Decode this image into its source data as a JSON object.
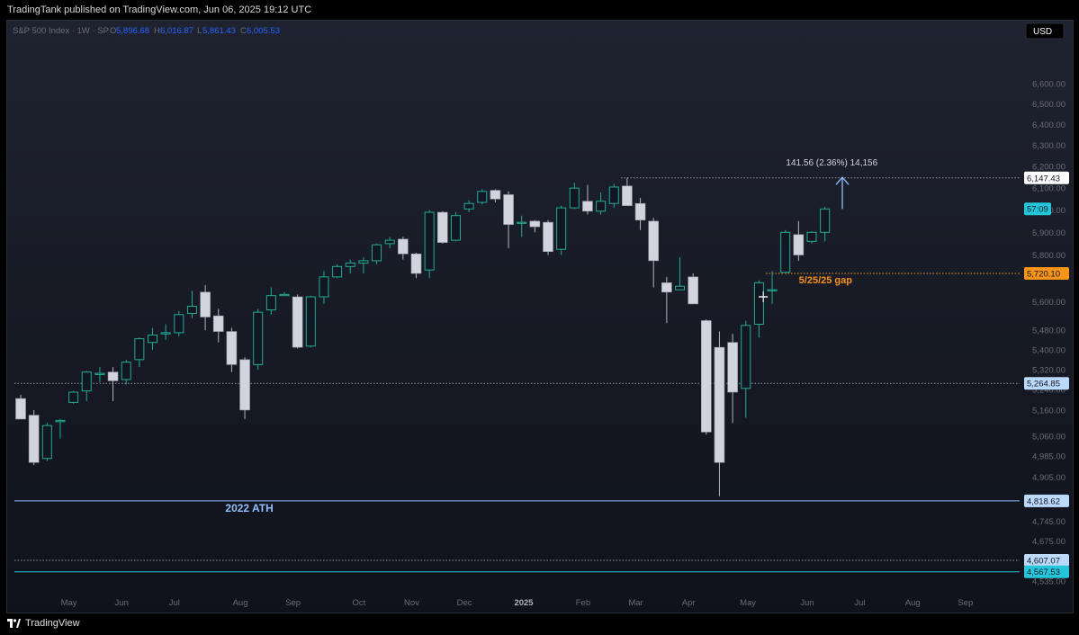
{
  "header": {
    "publish_text": "TradingTank published on TradingView.com, Jun 06, 2025 19:12 UTC"
  },
  "footer": {
    "brand": "TradingView"
  },
  "symbol_info": {
    "name": "S&P 500 Index · 1W · SP",
    "open_label": "O",
    "open": "5,896.68",
    "high_label": "H",
    "high": "6,016.87",
    "low_label": "L",
    "low": "5,861.43",
    "close_label": "C",
    "close": "6,005.53"
  },
  "currency": "USD",
  "colors": {
    "up": "#22ab94",
    "down_fill": "#d1d4dc",
    "bg": "#121622",
    "axis_text": "#6a6d78",
    "orange": "#f7931a",
    "blue_line": "#90bff9",
    "teal_line": "#26c6da"
  },
  "chart_data": {
    "type": "candlestick",
    "title": "S&P 500 Index · 1W · SP",
    "ylim": [
      4545,
      6745
    ],
    "y_scale": "log",
    "y_ticks": [
      6600,
      6500,
      6400,
      6300,
      6200,
      6100,
      6000,
      5900,
      5800,
      5720,
      5600,
      5480,
      5400,
      5320,
      5240,
      5160,
      5060,
      4985,
      4905,
      4818,
      4745,
      4675,
      4607,
      4535
    ],
    "y_tick_labels": [
      "6,600.00",
      "6,500.00",
      "6,400.00",
      "6,300.00",
      "6,200.00",
      "6,100.00",
      "6,000.00",
      "5,900.00",
      "5,800.00",
      "5,720.00",
      "5,600.00",
      "5,480.00",
      "5,400.00",
      "5,320.00",
      "5,240.00",
      "5,160.00",
      "5,060.00",
      "4,985.00",
      "4,905.00",
      "4,818.00",
      "4,745.00",
      "4,675.00",
      "4,607.00",
      "4,535.00"
    ],
    "x_labels": [
      {
        "label": "May",
        "week": 4
      },
      {
        "label": "Jun",
        "week": 8
      },
      {
        "label": "Jul",
        "week": 12
      },
      {
        "label": "Aug",
        "week": 17
      },
      {
        "label": "Sep",
        "week": 21
      },
      {
        "label": "Oct",
        "week": 26
      },
      {
        "label": "Nov",
        "week": 30
      },
      {
        "label": "Dec",
        "week": 34
      },
      {
        "label": "2025",
        "week": 38.5
      },
      {
        "label": "Feb",
        "week": 43
      },
      {
        "label": "Mar",
        "week": 47
      },
      {
        "label": "Apr",
        "week": 51
      },
      {
        "label": "May",
        "week": 55.5
      },
      {
        "label": "Jun",
        "week": 60
      },
      {
        "label": "Jul",
        "week": 64
      },
      {
        "label": "Aug",
        "week": 68
      },
      {
        "label": "Sep",
        "week": 72
      }
    ],
    "candles": [
      {
        "o": 5205,
        "h": 5220,
        "l": 5130,
        "c": 5125
      },
      {
        "o": 5140,
        "h": 5160,
        "l": 4950,
        "c": 4960
      },
      {
        "o": 4975,
        "h": 5110,
        "l": 4965,
        "c": 5100
      },
      {
        "o": 5115,
        "h": 5125,
        "l": 5050,
        "c": 5120
      },
      {
        "o": 5190,
        "h": 5235,
        "l": 5185,
        "c": 5230
      },
      {
        "o": 5235,
        "h": 5315,
        "l": 5195,
        "c": 5310
      },
      {
        "o": 5300,
        "h": 5330,
        "l": 5270,
        "c": 5305
      },
      {
        "o": 5310,
        "h": 5330,
        "l": 5195,
        "c": 5275
      },
      {
        "o": 5280,
        "h": 5360,
        "l": 5260,
        "c": 5350
      },
      {
        "o": 5360,
        "h": 5450,
        "l": 5330,
        "c": 5445
      },
      {
        "o": 5430,
        "h": 5490,
        "l": 5400,
        "c": 5460
      },
      {
        "o": 5465,
        "h": 5505,
        "l": 5440,
        "c": 5470
      },
      {
        "o": 5470,
        "h": 5560,
        "l": 5455,
        "c": 5545
      },
      {
        "o": 5550,
        "h": 5645,
        "l": 5530,
        "c": 5580
      },
      {
        "o": 5640,
        "h": 5670,
        "l": 5480,
        "c": 5535
      },
      {
        "o": 5540,
        "h": 5570,
        "l": 5430,
        "c": 5475
      },
      {
        "o": 5475,
        "h": 5490,
        "l": 5310,
        "c": 5340
      },
      {
        "o": 5360,
        "h": 5370,
        "l": 5125,
        "c": 5160
      },
      {
        "o": 5340,
        "h": 5570,
        "l": 5320,
        "c": 5555
      },
      {
        "o": 5565,
        "h": 5660,
        "l": 5545,
        "c": 5625
      },
      {
        "o": 5625,
        "h": 5640,
        "l": 5625,
        "c": 5630
      },
      {
        "o": 5620,
        "h": 5630,
        "l": 5405,
        "c": 5410
      },
      {
        "o": 5415,
        "h": 5625,
        "l": 5410,
        "c": 5620
      },
      {
        "o": 5620,
        "h": 5730,
        "l": 5590,
        "c": 5705
      },
      {
        "o": 5705,
        "h": 5760,
        "l": 5700,
        "c": 5750
      },
      {
        "o": 5750,
        "h": 5780,
        "l": 5720,
        "c": 5765
      },
      {
        "o": 5765,
        "h": 5790,
        "l": 5720,
        "c": 5775
      },
      {
        "o": 5775,
        "h": 5850,
        "l": 5760,
        "c": 5845
      },
      {
        "o": 5850,
        "h": 5880,
        "l": 5830,
        "c": 5865
      },
      {
        "o": 5870,
        "h": 5880,
        "l": 5780,
        "c": 5805
      },
      {
        "o": 5805,
        "h": 5810,
        "l": 5700,
        "c": 5720
      },
      {
        "o": 5735,
        "h": 6000,
        "l": 5700,
        "c": 5990
      },
      {
        "o": 5990,
        "h": 5995,
        "l": 5850,
        "c": 5855
      },
      {
        "o": 5865,
        "h": 5990,
        "l": 5860,
        "c": 5975
      },
      {
        "o": 6005,
        "h": 6045,
        "l": 5990,
        "c": 6030
      },
      {
        "o": 6035,
        "h": 6095,
        "l": 6025,
        "c": 6085
      },
      {
        "o": 6090,
        "h": 6095,
        "l": 6035,
        "c": 6050
      },
      {
        "o": 6070,
        "h": 6085,
        "l": 5830,
        "c": 5935
      },
      {
        "o": 5940,
        "h": 5975,
        "l": 5880,
        "c": 5945
      },
      {
        "o": 5950,
        "h": 5955,
        "l": 5900,
        "c": 5925
      },
      {
        "o": 5945,
        "h": 5955,
        "l": 5800,
        "c": 5815
      },
      {
        "o": 5825,
        "h": 6020,
        "l": 5800,
        "c": 6010
      },
      {
        "o": 6010,
        "h": 6125,
        "l": 6005,
        "c": 6100
      },
      {
        "o": 6040,
        "h": 6115,
        "l": 5980,
        "c": 5995
      },
      {
        "o": 5995,
        "h": 6080,
        "l": 5980,
        "c": 6040
      },
      {
        "o": 6030,
        "h": 6120,
        "l": 6010,
        "c": 6105
      },
      {
        "o": 6110,
        "h": 6147,
        "l": 6030,
        "c": 6020
      },
      {
        "o": 6030,
        "h": 6055,
        "l": 5910,
        "c": 5955
      },
      {
        "o": 5950,
        "h": 5965,
        "l": 5660,
        "c": 5775
      },
      {
        "o": 5680,
        "h": 5705,
        "l": 5510,
        "c": 5640
      },
      {
        "o": 5650,
        "h": 5790,
        "l": 5660,
        "c": 5665
      },
      {
        "o": 5705,
        "h": 5720,
        "l": 5590,
        "c": 5590
      },
      {
        "o": 5520,
        "h": 5525,
        "l": 5065,
        "c": 5075
      },
      {
        "o": 5410,
        "h": 5475,
        "l": 4835,
        "c": 4960
      },
      {
        "o": 5430,
        "h": 5465,
        "l": 5110,
        "c": 5230
      },
      {
        "o": 5245,
        "h": 5520,
        "l": 5130,
        "c": 5500
      },
      {
        "o": 5505,
        "h": 5690,
        "l": 5450,
        "c": 5680
      },
      {
        "o": 5650,
        "h": 5730,
        "l": 5590,
        "c": 5650
      },
      {
        "o": 5725,
        "h": 5910,
        "l": 5720,
        "c": 5900
      },
      {
        "o": 5890,
        "h": 5950,
        "l": 5775,
        "c": 5800
      },
      {
        "o": 5860,
        "h": 5905,
        "l": 5850,
        "c": 5900
      },
      {
        "o": 5900,
        "h": 6015,
        "l": 5860,
        "c": 6005
      }
    ],
    "price_labels": [
      {
        "text": "6,147.43",
        "value": 6147.43,
        "style": "white"
      },
      {
        "text": "57:09",
        "value": 6005.53,
        "style": "teal"
      },
      {
        "text": "5,720.10",
        "value": 5720.1,
        "style": "orange"
      },
      {
        "text": "5,264.85",
        "value": 5264.85,
        "style": "lightblue"
      },
      {
        "text": "4,818.62",
        "value": 4818.62,
        "style": "lightblue"
      },
      {
        "text": "4,607.07",
        "value": 4607.07,
        "style": "lightblue"
      },
      {
        "text": "4,567.53",
        "value": 4567.53,
        "style": "teal"
      }
    ],
    "horizontal_lines": [
      {
        "value": 6147.43,
        "style": "dotted",
        "color": "#9598a1",
        "from_week": 46
      },
      {
        "value": 5720.1,
        "style": "dotted",
        "color": "#f7931a",
        "from_week": 57
      },
      {
        "value": 5264.85,
        "style": "dotted",
        "color": "#9598a1",
        "from_week": 0
      },
      {
        "value": 4818.62,
        "style": "solid",
        "color": "#90bff9",
        "from_week": 0
      },
      {
        "value": 4607.07,
        "style": "dotted",
        "color": "#9598a1",
        "from_week": 0
      },
      {
        "value": 4567.53,
        "style": "solid",
        "color": "#26c6da",
        "from_week": 0
      }
    ],
    "annotations": [
      {
        "text": "2022 ATH",
        "value": 4818.62,
        "week": 16,
        "color": "#90bff9"
      },
      {
        "text": "5/25/25 gap",
        "value": 5720.1,
        "week": 59.5,
        "color": "#f7931a"
      },
      {
        "text": "141.56 (2.36%) 14,156",
        "value": 6147.43,
        "week": 62,
        "color": "#d1d4dc"
      }
    ],
    "arrow": {
      "from_value": 6005,
      "to_value": 6150,
      "week": 62.8
    },
    "measure_marker": {
      "value": 5620,
      "week": 56.8
    }
  }
}
